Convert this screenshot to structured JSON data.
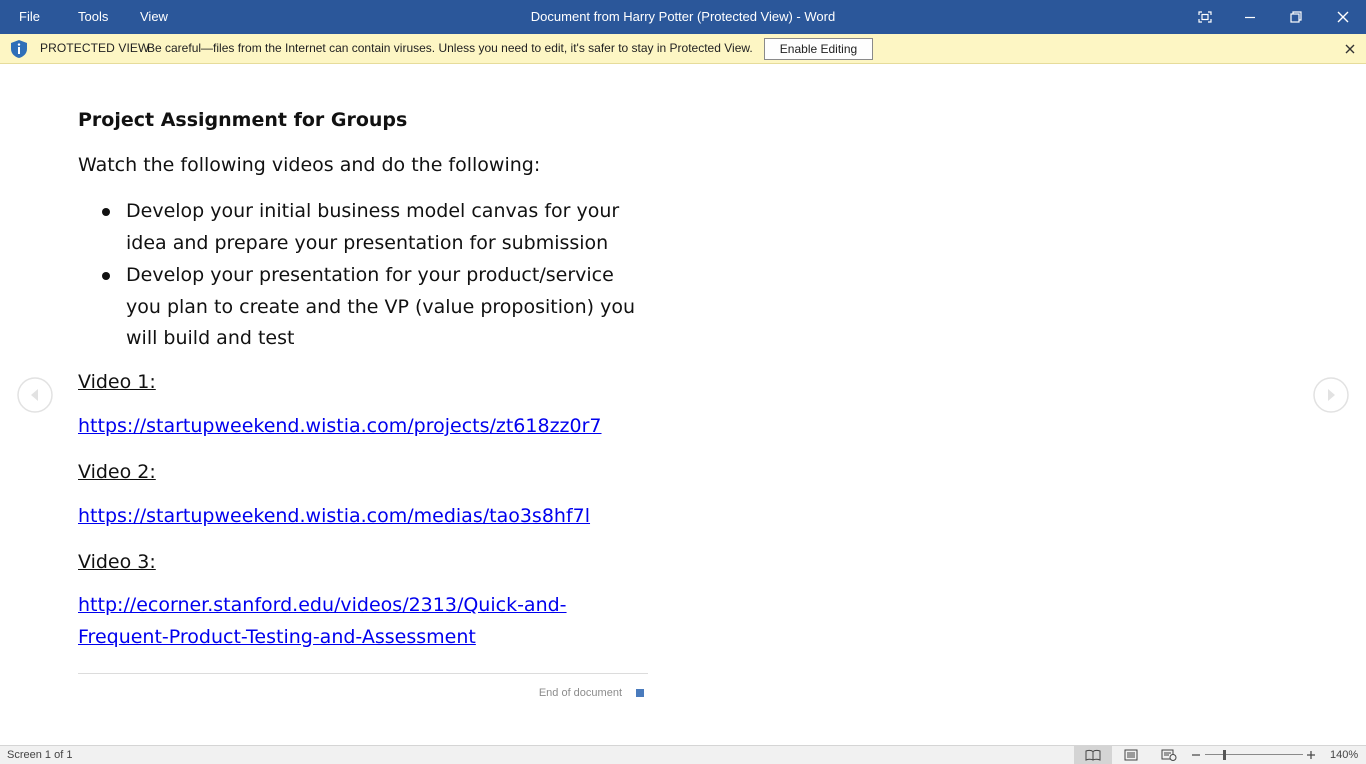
{
  "titlebar": {
    "menu": [
      "File",
      "Tools",
      "View"
    ],
    "title": "Document from Harry Potter (Protected View) - Word",
    "background": "#2b579a"
  },
  "protected_view": {
    "label": "PROTECTED VIEW",
    "message": "Be careful—files from the Internet can contain viruses. Unless you need to edit, it's safer to stay in Protected View.",
    "enable_button": "Enable Editing",
    "icon": "shield-info-icon",
    "background": "#fdf6c4"
  },
  "document": {
    "heading": "Project Assignment for Groups",
    "intro": "Watch the following videos and do the following:",
    "bullets": [
      "Develop your initial business model canvas for your idea and prepare your presentation for submission",
      "Develop your presentation for your product/service you plan to create and the VP (value proposition) you will build and test"
    ],
    "videos": [
      {
        "label": "Video 1:",
        "link": "https://startupweekend.wistia.com/projects/zt618zz0r7"
      },
      {
        "label": "Video 2:",
        "link": "https://startupweekend.wistia.com/medias/tao3s8hf7l"
      },
      {
        "label": "Video 3:",
        "link": "http://ecorner.stanford.edu/videos/2313/Quick-and-Frequent-Product-Testing-and-Assessment"
      }
    ],
    "end_text": "End of document",
    "link_color": "#0000ee"
  },
  "statusbar": {
    "page_info": "Screen 1 of 1",
    "zoom": "140%"
  }
}
